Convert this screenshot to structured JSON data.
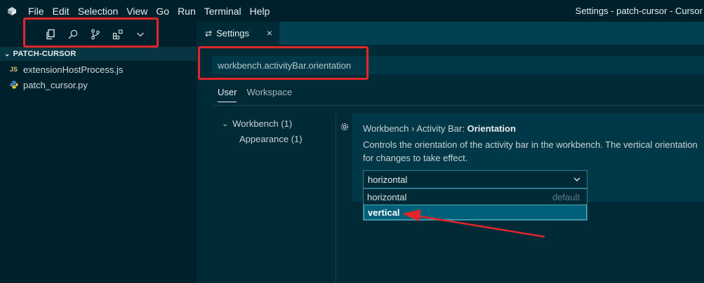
{
  "menu": {
    "items": [
      "File",
      "Edit",
      "Selection",
      "View",
      "Go",
      "Run",
      "Terminal",
      "Help"
    ]
  },
  "window_title": "Settings - patch-cursor - Cursor",
  "sidebar": {
    "icons": [
      "files-icon",
      "search-icon",
      "source-control-icon",
      "extensions-icon",
      "chevron-down-icon"
    ],
    "folder_name": "PATCH-CURSOR",
    "files": [
      {
        "name": "extensionHostProcess.js",
        "icon": "JS"
      },
      {
        "name": "patch_cursor.py",
        "icon": "python-icon"
      }
    ]
  },
  "tab": {
    "label": "Settings",
    "close": "×"
  },
  "settings": {
    "search_value": "workbench.activityBar.orientation",
    "scope_tabs": [
      "User",
      "Workspace"
    ],
    "toc": {
      "group": "Workbench (1)",
      "sub": "Appearance (1)"
    },
    "item": {
      "title_prefix": "Workbench › Activity Bar: ",
      "title_name": "Orientation",
      "desc_line1": "Controls the orientation of the activity bar in the workbench. The vertical orientation",
      "desc_line2": "for changes to take effect.",
      "current_value": "horizontal",
      "options": [
        {
          "label": "horizontal",
          "desc": "default"
        },
        {
          "label": "vertical",
          "desc": ""
        }
      ]
    }
  },
  "colors": {
    "background": "#002b36",
    "sidebar": "#00212b",
    "annotation": "#e0262b"
  }
}
